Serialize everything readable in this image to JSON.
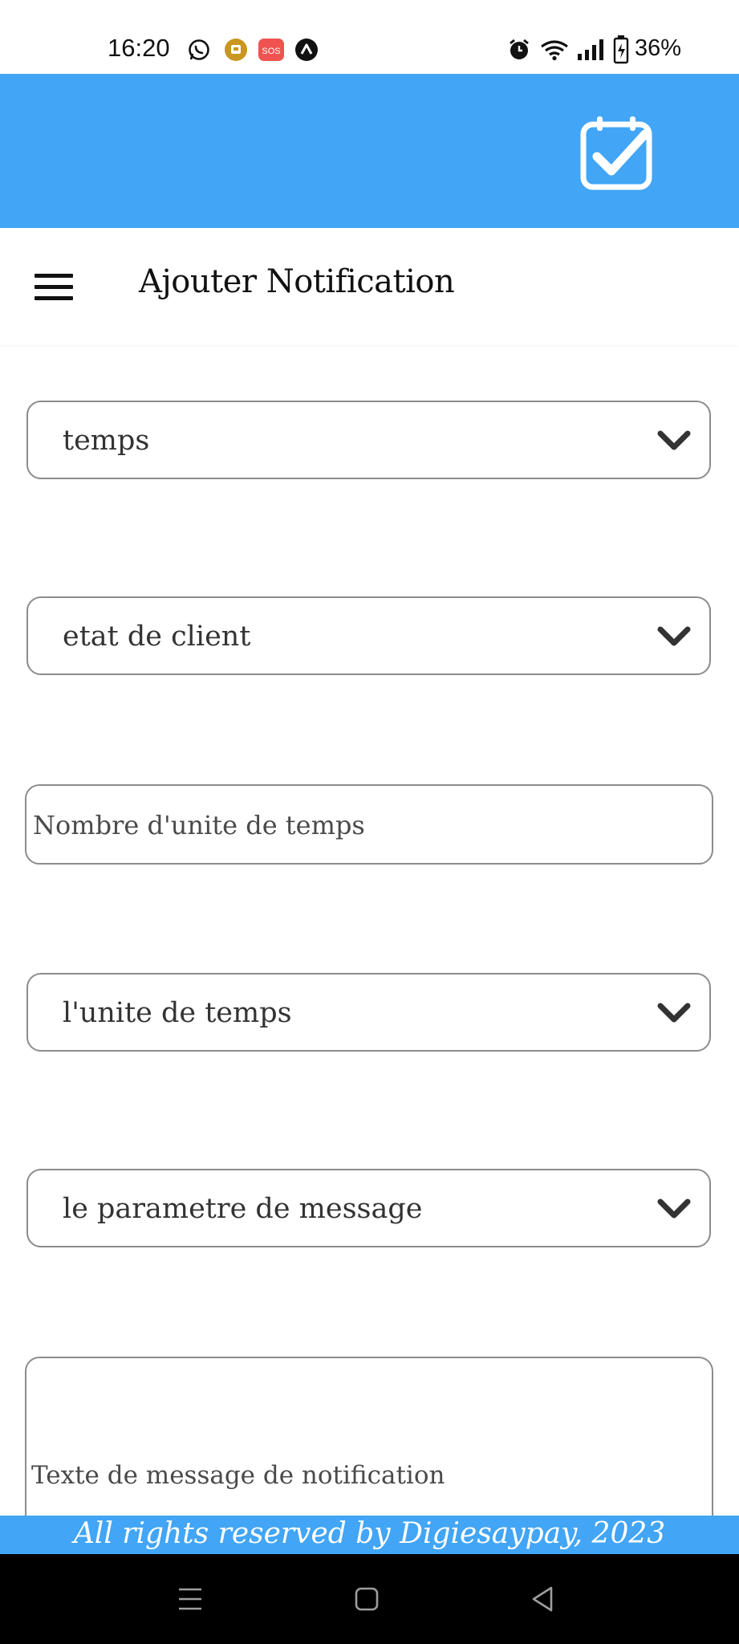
{
  "status_bar": {
    "time": "16:20",
    "icons_left": [
      "whatsapp-icon",
      "app-icon",
      "sos-icon",
      "arc-icon"
    ],
    "sos_text": "SOS",
    "battery": "36%"
  },
  "header": {
    "logo_icon": "calendar-check-icon",
    "accent_color": "#42a5f5"
  },
  "titlebar": {
    "title": "Ajouter Notification"
  },
  "form": {
    "temps": "temps",
    "etat_client": "etat de client",
    "nombre_placeholder": "Nombre d'unite de temps",
    "unite_temps": "l'unite de temps",
    "parametre_message": "le parametre de message",
    "texte_placeholder": "Texte de message de notification"
  },
  "footer": {
    "text": "All rights reserved by Digiesaypay, 2023"
  }
}
